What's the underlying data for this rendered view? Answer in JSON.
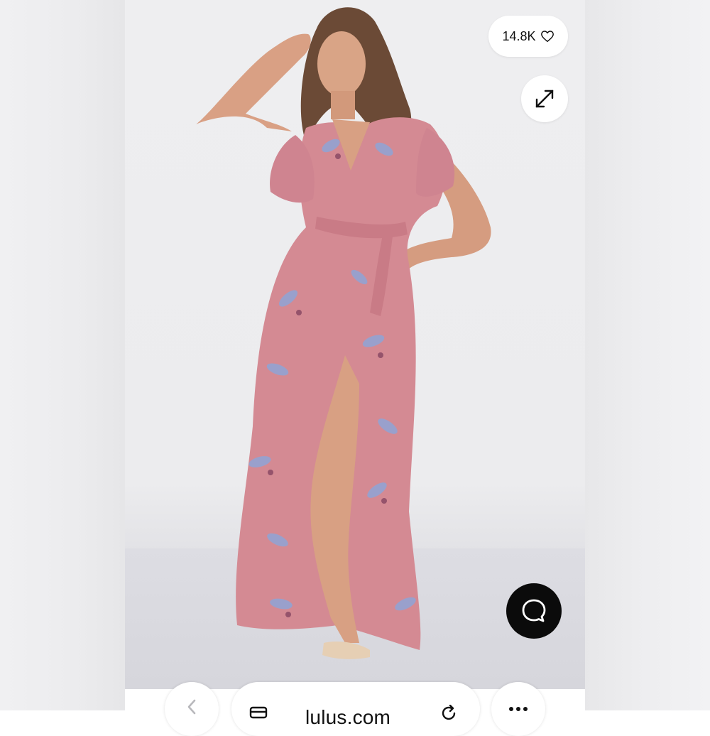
{
  "likes": {
    "count": "14.8K",
    "icon": "heart-outline-icon"
  },
  "expand": {
    "icon": "expand-arrows-icon"
  },
  "chat": {
    "icon": "chat-bubble-icon"
  },
  "browser": {
    "url": "lulus.com",
    "back_icon": "chevron-left-icon",
    "tabs_icon": "tabs-icon",
    "reload_icon": "reload-icon",
    "more_icon": "more-dots-icon"
  },
  "colors": {
    "dress": "#d48a93",
    "chat_button": "#0b0b0b",
    "background": "#ececee"
  }
}
